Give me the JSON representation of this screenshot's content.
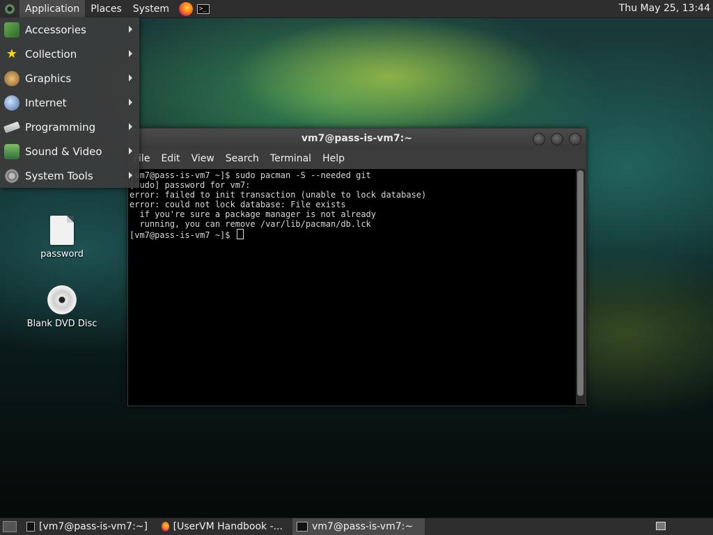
{
  "top_panel": {
    "menus": [
      "Application",
      "Places",
      "System"
    ],
    "clock": "Thu May 25, 13:44"
  },
  "app_menu": {
    "items": [
      {
        "label": "Accessories",
        "icon": "accessories-icon"
      },
      {
        "label": "Collection",
        "icon": "star-icon"
      },
      {
        "label": "Graphics",
        "icon": "graphics-icon"
      },
      {
        "label": "Internet",
        "icon": "globe-icon"
      },
      {
        "label": "Programming",
        "icon": "programming-icon"
      },
      {
        "label": "Sound & Video",
        "icon": "multimedia-icon"
      },
      {
        "label": "System Tools",
        "icon": "system-tools-icon"
      }
    ]
  },
  "desktop": {
    "icons": [
      {
        "label": "password",
        "icon": "file-icon"
      },
      {
        "label": "Blank DVD Disc",
        "icon": "dvd-disc-icon"
      }
    ]
  },
  "terminal": {
    "title": "vm7@pass-is-vm7:~",
    "menus": [
      "File",
      "Edit",
      "View",
      "Search",
      "Terminal",
      "Help"
    ],
    "lines": [
      "[vm7@pass-is-vm7 ~]$ sudo pacman -S --needed git",
      "[sudo] password for vm7:",
      "error: failed to init transaction (unable to lock database)",
      "error: could not lock database: File exists",
      "  if you're sure a package manager is not already",
      "  running, you can remove /var/lib/pacman/db.lck",
      "[vm7@pass-is-vm7 ~]$ "
    ]
  },
  "taskbar": {
    "tasks": [
      {
        "label": "[vm7@pass-is-vm7:~]",
        "icon": "terminal-icon"
      },
      {
        "label": "[UserVM Handbook -...",
        "icon": "firefox-icon"
      },
      {
        "label": "vm7@pass-is-vm7:~",
        "icon": "terminal-icon"
      }
    ]
  }
}
